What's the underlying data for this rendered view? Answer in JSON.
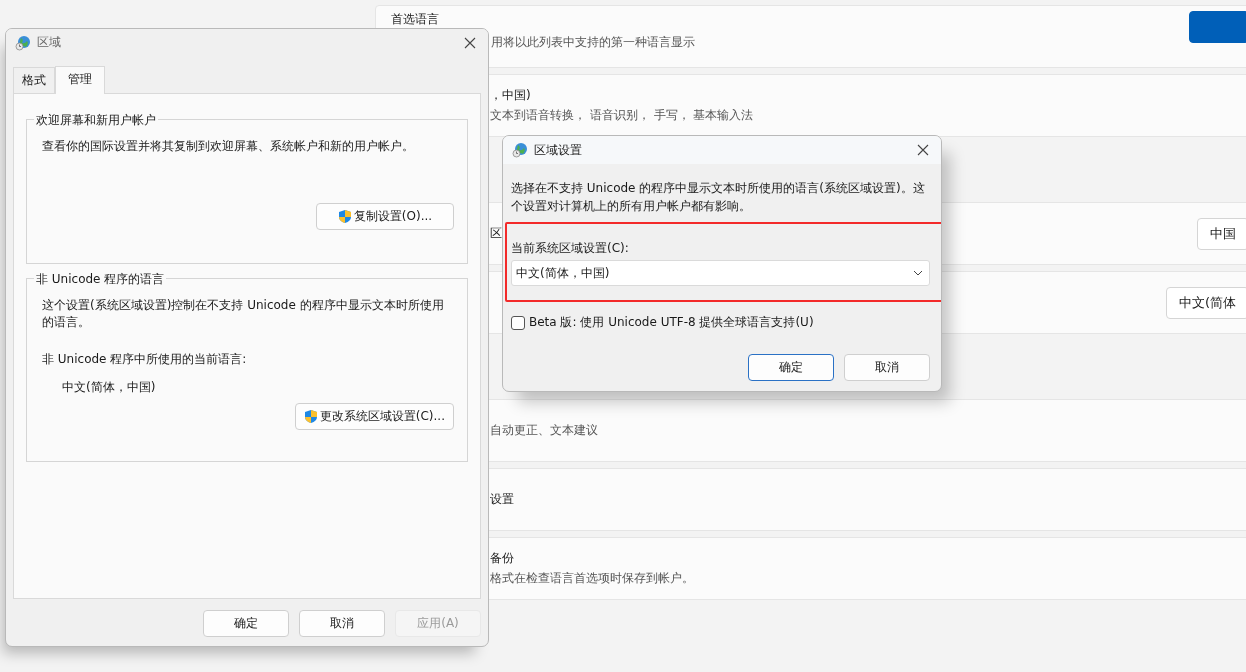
{
  "settings_page": {
    "groups": [
      {
        "cards": [
          {
            "kind": "header",
            "title": "首选语言",
            "subtitle": "用将以此列表中支持的第一种语言显示",
            "button": {
              "kind": "primary"
            }
          },
          {
            "kind": "item",
            "title": "，中国)",
            "subtitle": "文本到语音转换， 语音识别， 手写， 基本输入法"
          }
        ]
      },
      {
        "cards": [
          {
            "kind": "item",
            "title": "区",
            "button": {
              "kind": "secondary",
              "label": "中国"
            }
          },
          {
            "kind": "item",
            "button": {
              "kind": "secondary",
              "label": "中文(简体"
            }
          }
        ]
      },
      {
        "cards": [
          {
            "kind": "item",
            "subtitle": "自动更正、文本建议"
          },
          {
            "kind": "item",
            "title": "设置"
          },
          {
            "kind": "item",
            "title": "备份",
            "subtitle": "格式在检查语言首选项时保存到帐户。"
          }
        ]
      }
    ]
  },
  "region_dialog": {
    "title": "区域",
    "tabs": [
      {
        "label": "格式",
        "selected": false
      },
      {
        "label": "管理",
        "selected": true
      }
    ],
    "groups": [
      {
        "legend": "欢迎屏幕和新用户帐户",
        "text": "查看你的国际设置并将其复制到欢迎屏幕、系统帐户和新的用户帐户。",
        "button": {
          "label": "复制设置(O)...",
          "shield": true
        }
      },
      {
        "legend": "非 Unicode 程序的语言",
        "text": "这个设置(系统区域设置)控制在不支持 Unicode 的程序中显示文本时所使用的语言。",
        "label": "非 Unicode 程序中所使用的当前语言:",
        "value": "中文(简体，中国)",
        "button": {
          "label": "更改系统区域设置(C)...",
          "shield": true
        }
      }
    ],
    "buttons": [
      {
        "label": "确定",
        "disabled": false
      },
      {
        "label": "取消",
        "disabled": false
      },
      {
        "label": "应用(A)",
        "disabled": true
      }
    ]
  },
  "locale_dialog": {
    "title": "区域设置",
    "description": "选择在不支持 Unicode 的程序中显示文本时所使用的语言(系统区域设置)。这个设置对计算机上的所有用户帐户都有影响。",
    "field_label": "当前系统区域设置(C):",
    "field_value": "中文(简体，中国)",
    "highlighted": true,
    "checkbox": {
      "label": "Beta 版: 使用 Unicode UTF-8 提供全球语言支持(U)",
      "checked": false
    },
    "buttons": [
      {
        "label": "确定",
        "default": true
      },
      {
        "label": "取消",
        "default": false
      }
    ]
  }
}
